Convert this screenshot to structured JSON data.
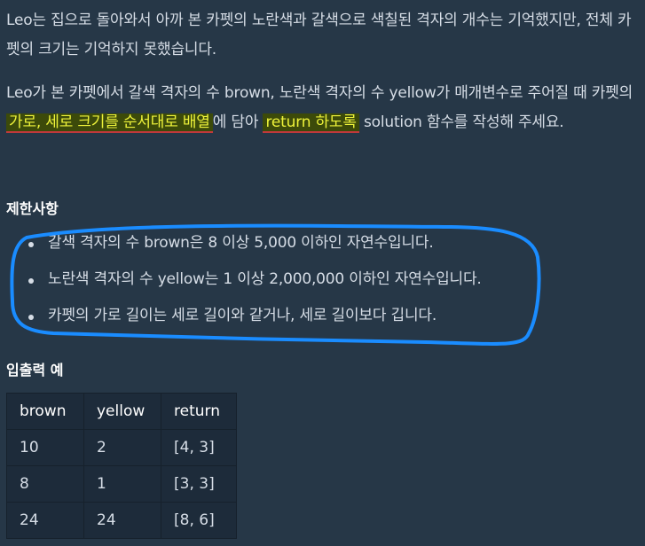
{
  "description": {
    "p1": "Leo는 집으로 돌아와서 아까 본 카펫의 노란색과 갈색으로 색칠된 격자의 개수는 기억했지만, 전체 카펫의 크기는 기억하지 못했습니다.",
    "p2_a": "Leo가 본 카펫에서 갈색 격자의 수 brown, 노란색 격자의 수 yellow가 매개변수로 주어질 때 카펫의 ",
    "p2_hl1": "가로, 세로 크기를 순서대로 배열",
    "p2_b": "에 담아 ",
    "p2_hl2": "return 하도록",
    "p2_c": " solution 함수를 작성해 주세요."
  },
  "constraints": {
    "title": "제한사항",
    "items": [
      "갈색 격자의 수 brown은 8 이상 5,000 이하인 자연수입니다.",
      "노란색 격자의 수 yellow는 1 이상 2,000,000 이하인 자연수입니다.",
      "카펫의 가로 길이는 세로 길이와 같거나, 세로 길이보다 깁니다."
    ]
  },
  "examples": {
    "title": "입출력 예",
    "headers": [
      "brown",
      "yellow",
      "return"
    ],
    "rows": [
      [
        "10",
        "2",
        "[4, 3]"
      ],
      [
        "8",
        "1",
        "[3, 3]"
      ],
      [
        "24",
        "24",
        "[8, 6]"
      ]
    ]
  },
  "colors": {
    "background": "#263747",
    "highlight_text": "#eef33a",
    "highlight_bg": "#3c4a0a",
    "underline": "#c0393b",
    "annotation": "#1a8cff"
  }
}
